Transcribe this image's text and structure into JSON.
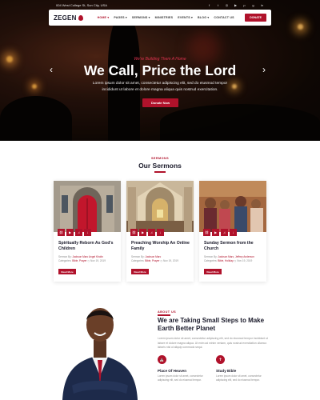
{
  "topbar": {
    "address": "004 West College St, Sun City, USA",
    "socials": [
      "f-icon",
      "t-icon",
      "in-icon",
      "yt-icon",
      "p-icon",
      "g-icon",
      "p2-icon"
    ]
  },
  "nav": {
    "logo": "ZEGEN",
    "items": [
      {
        "label": "HOME ▾",
        "active": true
      },
      {
        "label": "PAGES ▾",
        "active": false
      },
      {
        "label": "SERMONS ▾",
        "active": false
      },
      {
        "label": "MINISTRIES",
        "active": false
      },
      {
        "label": "EVENTS ▾",
        "active": false
      },
      {
        "label": "BLOG ▾",
        "active": false
      },
      {
        "label": "CONTACT US",
        "active": false
      }
    ],
    "donate": "DONATE"
  },
  "hero": {
    "subtitle": "We're Building Them A Home",
    "title": "We Call, Price the Lord",
    "text": "Lorem ipsum dolor sit amet, consectetur adipiscing elit, sed do eiusmod tempor incididunt ut labore et dolore magna aliqua quis nostrud exercitation.",
    "button": "Donate Now",
    "prev": "‹",
    "next": "›"
  },
  "sermons": {
    "eyebrow": "SERMONS",
    "title": "Our Sermons",
    "cards": [
      {
        "title": "Spiritually Reborn As God's Children",
        "meta1_label": "Sermon By:",
        "meta1_value": "Jackson Marc Angel Kholin",
        "meta2_label": "Categories:",
        "meta2_value": "Bible, Prayer",
        "date": "Nov 19, 2019",
        "button": "Read More"
      },
      {
        "title": "Preaching Worship An Online Family",
        "meta1_label": "Sermon By:",
        "meta1_value": "Jackson Marc",
        "meta2_label": "Categories:",
        "meta2_value": "Bible, Prayer",
        "date": "Nov 19, 2019",
        "button": "Read More"
      },
      {
        "title": "Sunday Sermon from the Church",
        "meta1_label": "Sermon By:",
        "meta1_value": "Jackson Marc, Jeffrey Anderson",
        "meta2_label": "Categories:",
        "meta2_value": "Bible, Holiday",
        "date": "Nov 19, 2019",
        "button": "Read More"
      }
    ],
    "card_icons": [
      "link-icon",
      "play-icon",
      "headphones-icon",
      "download-icon"
    ]
  },
  "about": {
    "eyebrow": "ABOUT US",
    "title": "We are Taking Small Steps to Make Earth Better Planet",
    "text": "Lorem ipsum dolor sit amet, consectetur adipiscing elit, sed do eiusmod tempor incididunt ut labore et dolore magna aliqua. Ut enim ad minim veniam, quis nostrud exercitation ullamco laboris nisi ut aliquip commodo sequi.",
    "features": [
      {
        "title": "Place Of Heaven",
        "text": "Lorem ipsum dolor sit amet, consectetur adipiscing elit, sed do eiusmod tempor."
      },
      {
        "title": "Study Bible",
        "text": "Lorem ipsum dolor sit amet, consectetur adipiscing elit, sed do eiusmod tempor."
      }
    ]
  },
  "colors": {
    "accent": "#b0122b",
    "dark": "#1a1a2a"
  }
}
